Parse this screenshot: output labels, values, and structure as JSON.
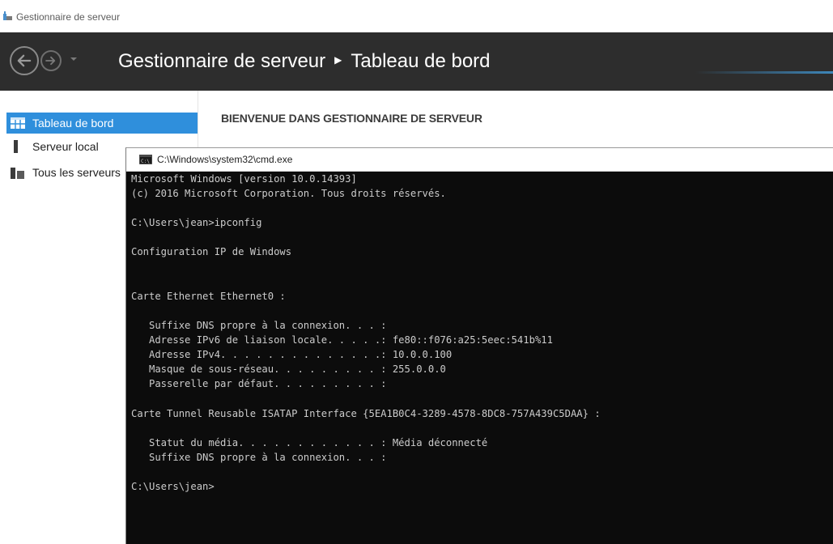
{
  "window": {
    "title": "Gestionnaire de serveur",
    "icon": "server-manager-icon"
  },
  "header": {
    "breadcrumb": [
      "Gestionnaire de serveur",
      "Tableau de bord"
    ],
    "separator": "▶",
    "back_icon": "back-arrow-icon",
    "forward_icon": "forward-arrow-icon",
    "history_icon": "chevron-down-icon"
  },
  "sidebar": {
    "items": [
      {
        "label": "Tableau de bord",
        "icon": "dashboard-icon",
        "selected": true
      },
      {
        "label": "Serveur local",
        "icon": "local-server-icon",
        "selected": false
      },
      {
        "label": "Tous les serveurs",
        "icon": "all-servers-icon",
        "selected": false
      }
    ]
  },
  "main": {
    "welcome_title": "BIENVENUE DANS GESTIONNAIRE DE SERVEUR"
  },
  "cmd": {
    "title": "C:\\Windows\\system32\\cmd.exe",
    "lines": [
      "Microsoft Windows [version 10.0.14393]",
      "(c) 2016 Microsoft Corporation. Tous droits réservés.",
      "",
      "C:\\Users\\jean>ipconfig",
      "",
      "Configuration IP de Windows",
      "",
      "",
      "Carte Ethernet Ethernet0 :",
      "",
      "   Suffixe DNS propre à la connexion. . . :",
      "   Adresse IPv6 de liaison locale. . . . .: fe80::f076:a25:5eec:541b%11",
      "   Adresse IPv4. . . . . . . . . . . . . .: 10.0.0.100",
      "   Masque de sous-réseau. . . . . . . . . : 255.0.0.0",
      "   Passerelle par défaut. . . . . . . . . :",
      "",
      "Carte Tunnel Reusable ISATAP Interface {5EA1B0C4-3289-4578-8DC8-757A439C5DAA} :",
      "",
      "   Statut du média. . . . . . . . . . . . : Média déconnecté",
      "   Suffixe DNS propre à la connexion. . . :",
      "",
      "C:\\Users\\jean>"
    ]
  },
  "colors": {
    "header_bg": "#2d2d2d",
    "selected_bg": "#2f8fdc",
    "console_bg": "#0c0c0c",
    "console_fg": "#cccccc"
  }
}
